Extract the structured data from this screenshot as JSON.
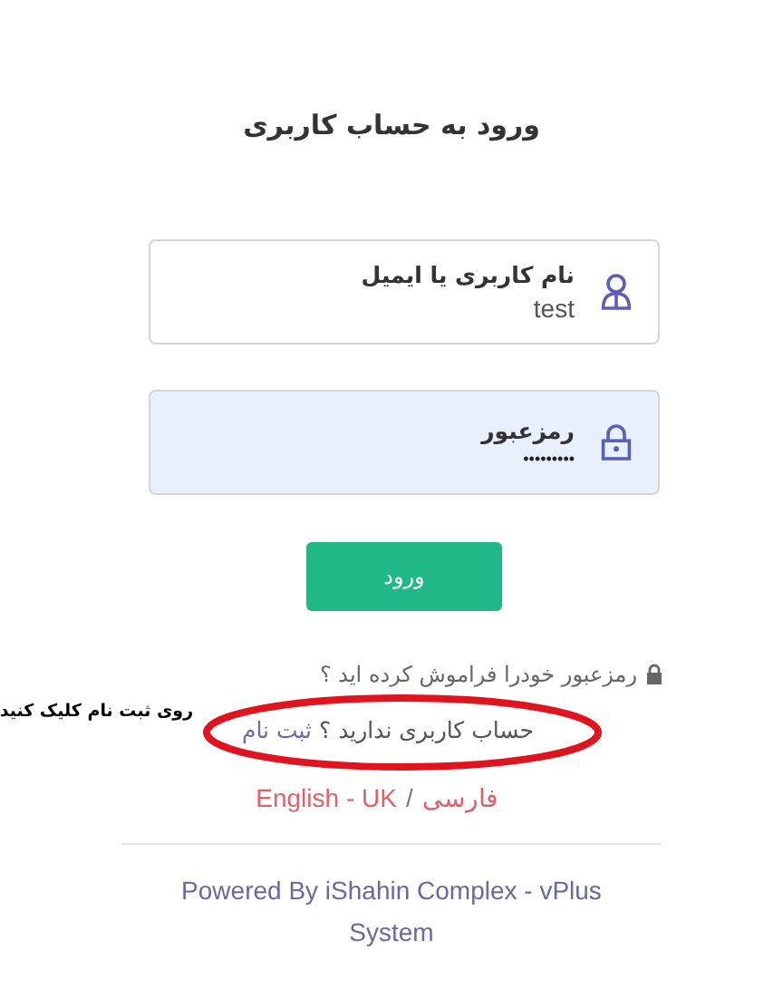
{
  "title": "ورود به حساب کاربری",
  "fields": [
    {
      "kind": "user",
      "label": "نام کاربری یا ایمیل",
      "value": "test",
      "autofilled": false
    },
    {
      "kind": "password",
      "label": "رمزعبور",
      "value": "•••••••••",
      "autofilled": true
    }
  ],
  "submit_button": "ورود",
  "forgot_link": "رمزعبور خودرا فراموش کرده اید ؟",
  "register": {
    "question": "حساب کاربری ندارید ؟",
    "link": "ثبت نام"
  },
  "annotation": {
    "text": "روی ثبت نام کلیک کنید"
  },
  "languages": [
    {
      "label": "فارسی"
    },
    {
      "label": "English - UK"
    }
  ],
  "language_separator": "/",
  "footer": "Powered By iShahin Complex - vPlus System"
}
